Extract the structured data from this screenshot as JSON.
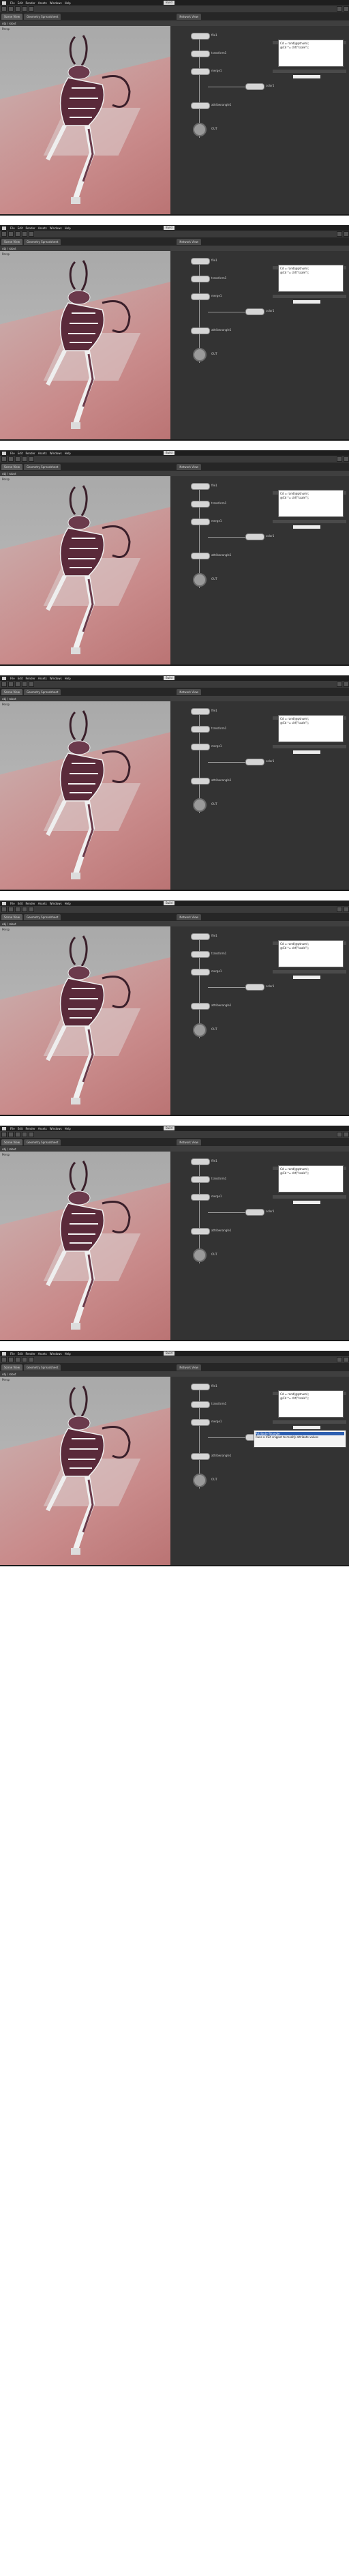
{
  "screen": {
    "menu": [
      "File",
      "Edit",
      "Render",
      "Assets",
      "Windows",
      "Help"
    ],
    "workspace": "Build",
    "tabs": [
      "Scene View",
      "Geometry Spreadsheet",
      "Network View"
    ],
    "path": "obj / robot",
    "viewport_label": "Persp",
    "nodes": [
      {
        "id": "file1",
        "label": "file1"
      },
      {
        "id": "transform1",
        "label": "transform1"
      },
      {
        "id": "merge1",
        "label": "merge1"
      },
      {
        "id": "color1",
        "label": "color1"
      },
      {
        "id": "attribwrangle1",
        "label": "attribwrangle1"
      },
      {
        "id": "output0",
        "label": "OUT"
      }
    ],
    "info_popup_lines": [
      "Cd = rand(@ptnum);",
      "@Cd *= chf(\"scale\");"
    ]
  },
  "frames": [
    {
      "index": 1
    },
    {
      "index": 2
    },
    {
      "index": 3
    },
    {
      "index": 4
    },
    {
      "index": 5
    },
    {
      "index": 6
    },
    {
      "index": 7,
      "tooltip": [
        "Attribute Wrangle",
        "Runs a VEX snippet to modify attribute values"
      ]
    }
  ],
  "colors": {
    "floor": "#c98b8b",
    "background": "#b0b0b0",
    "panel": "#2e2e2e",
    "robot": "#5a2a3a"
  }
}
